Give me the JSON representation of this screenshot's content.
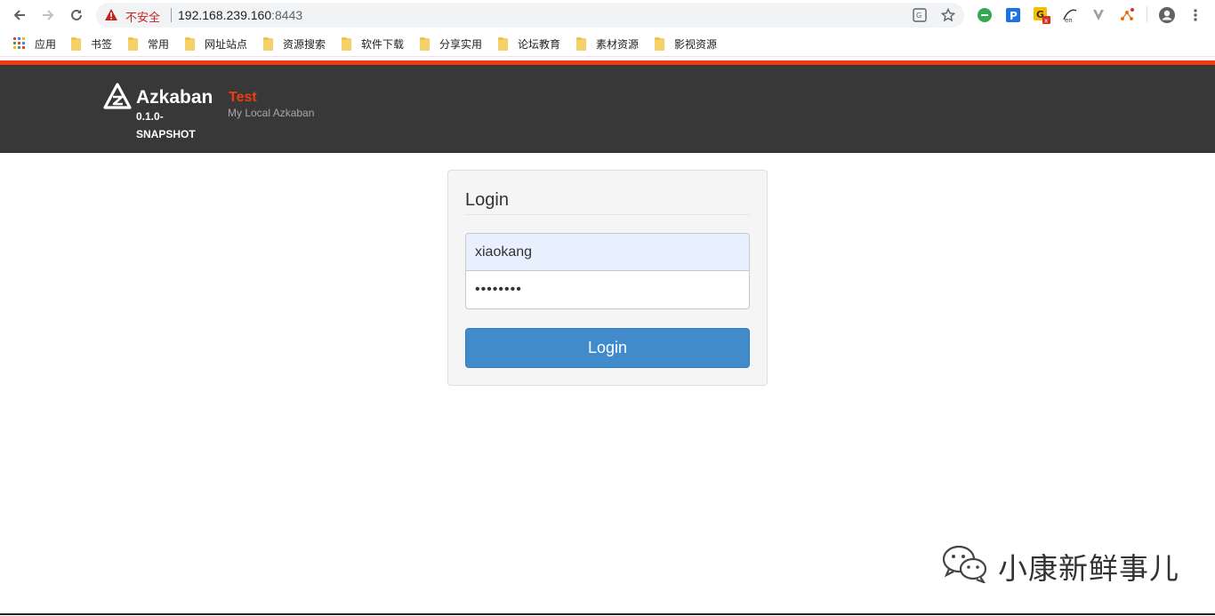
{
  "browser": {
    "security_label": "不安全",
    "url_host": "192.168.239.160",
    "url_port": ":8443"
  },
  "bookmarks": [
    {
      "label": "应用",
      "icon": "apps-grid-icon"
    },
    {
      "label": "书签",
      "icon": "folder-icon"
    },
    {
      "label": "常用",
      "icon": "folder-icon"
    },
    {
      "label": "网址站点",
      "icon": "folder-icon"
    },
    {
      "label": "资源搜索",
      "icon": "folder-icon"
    },
    {
      "label": "软件下载",
      "icon": "folder-icon"
    },
    {
      "label": "分享实用",
      "icon": "folder-icon"
    },
    {
      "label": "论坛教育",
      "icon": "folder-icon"
    },
    {
      "label": "素材资源",
      "icon": "folder-icon"
    },
    {
      "label": "影视资源",
      "icon": "folder-icon"
    }
  ],
  "header": {
    "brand": "Azkaban",
    "version": "0.1.0-SNAPSHOT",
    "env_name": "Test",
    "env_description": "My Local Azkaban"
  },
  "login": {
    "title": "Login",
    "username_value": "xiaokang",
    "password_mask": "••••••••",
    "button_label": "Login"
  },
  "watermark": {
    "text": "小康新鲜事儿"
  },
  "colors": {
    "accent_orange": "#f03c0f",
    "header_bg": "#383838",
    "button_blue": "#428bca"
  }
}
